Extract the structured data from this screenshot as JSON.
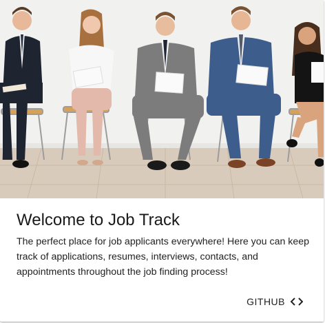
{
  "card": {
    "image_alt": "Job applicants seated in a waiting room holding papers",
    "title": "Welcome to Job Track",
    "description": "The perfect place for job applicants everywhere! Here you can keep track of applications, resumes, interviews, contacts, and appointments throughout the job finding process!",
    "action_label": "GITHUB",
    "action_icon": "code-icon"
  },
  "colors": {
    "wall": "#f2f2f0",
    "floor": "#d8c9b8",
    "text": "#222222"
  }
}
